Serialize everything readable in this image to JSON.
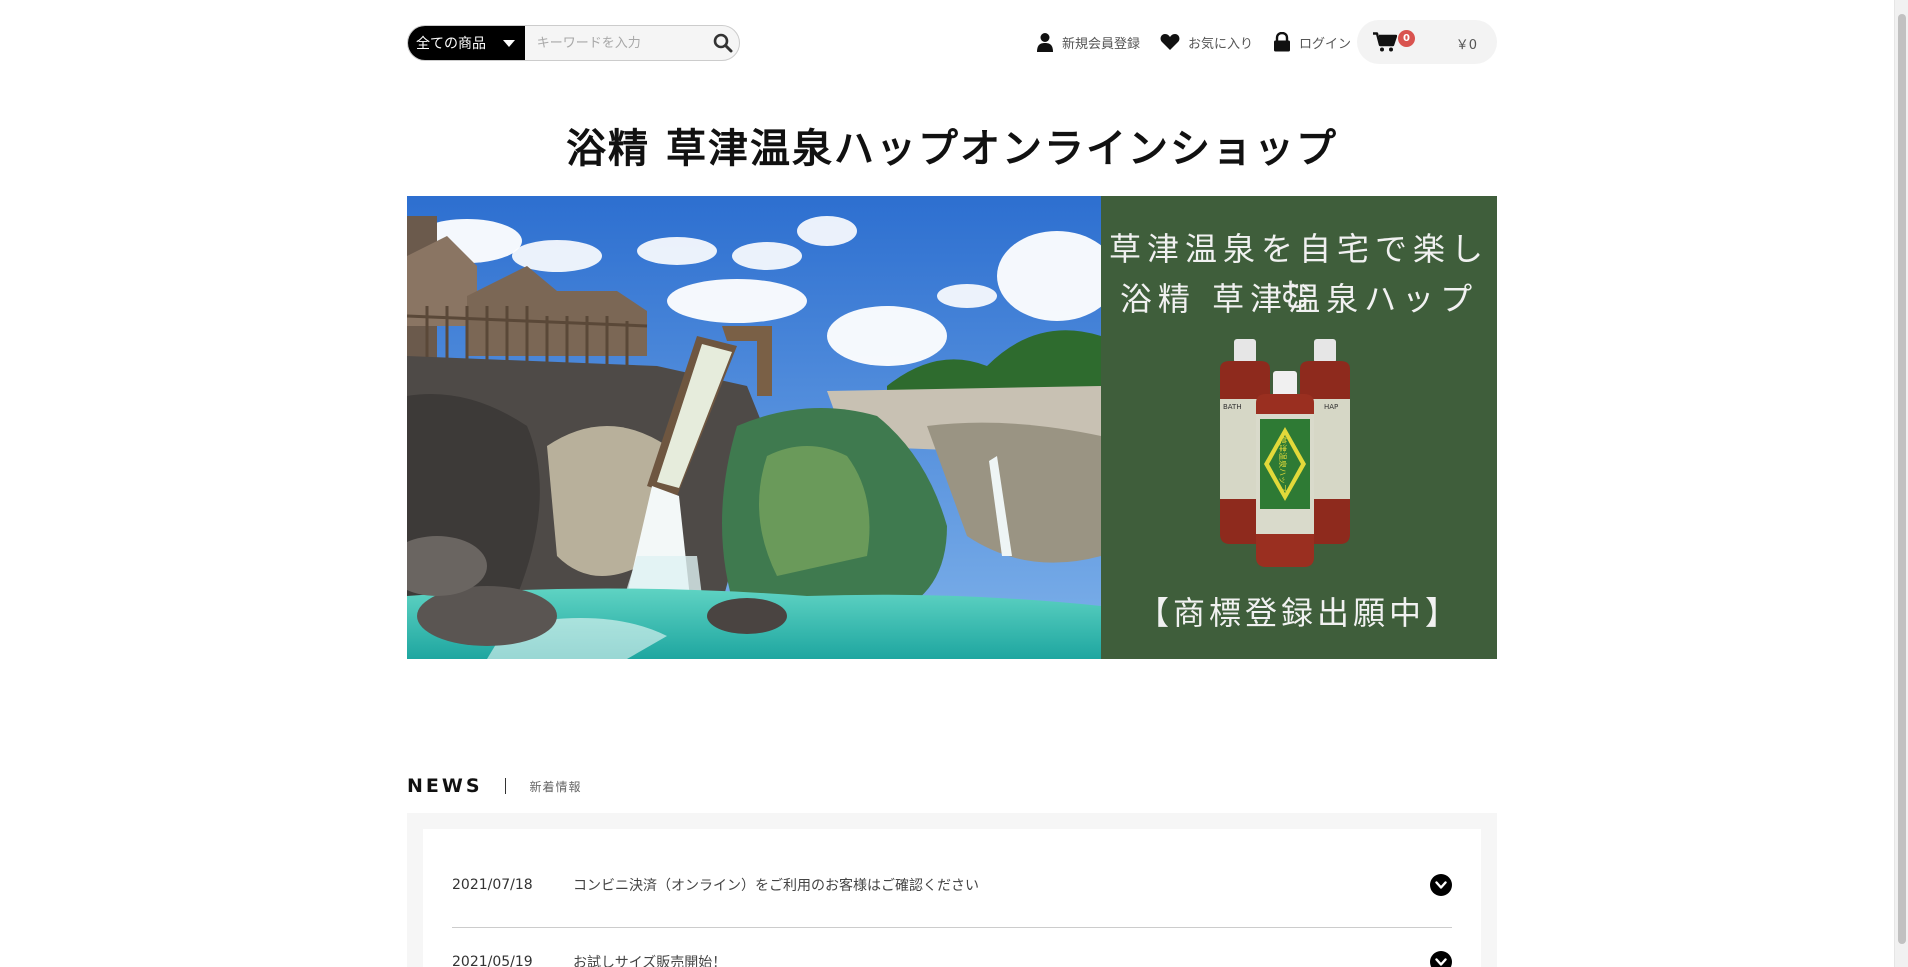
{
  "header": {
    "category_select": "全ての商品",
    "search_placeholder": "キーワードを入力",
    "nav": {
      "register": "新規会員登録",
      "favorites": "お気に入り",
      "login": "ログイン"
    },
    "cart": {
      "count": "0",
      "total": "￥0"
    }
  },
  "page_title": "浴精 草津温泉ハップオンラインショップ",
  "hero": {
    "line1": "草津温泉を自宅で楽しむ",
    "line2": "浴精 草津温泉ハップ",
    "line3": "【商標登録出願中】",
    "bottle_label_left": "BATH",
    "bottle_label_right": "HAP",
    "bottle_brand": "草津温泉ハップ"
  },
  "news": {
    "heading": "NEWS",
    "subheading": "新着情報",
    "items": [
      {
        "date": "2021/07/18",
        "title": "コンビニ決済（オンライン）をご利用のお客様はご確認ください"
      },
      {
        "date": "2021/05/19",
        "title": "お試しサイズ販売開始！"
      }
    ]
  },
  "colors": {
    "panel_green": "#3f5e3b",
    "badge_red": "#d9534f",
    "select_black": "#000000"
  }
}
